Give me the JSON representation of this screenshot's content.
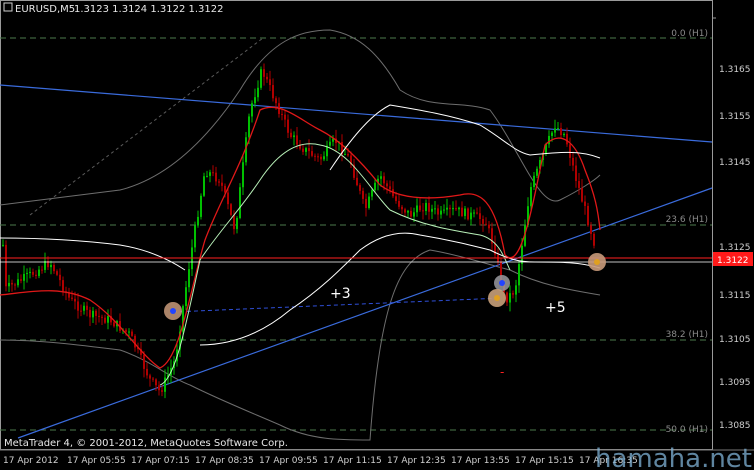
{
  "header": {
    "symbol": "EURUSD,M5",
    "quote": "1.3123 1.3124 1.3122 1.3122"
  },
  "price_axis": {
    "ticks": [
      "1.3165",
      "1.3155",
      "1.3145",
      "1.3125",
      "1.3115",
      "1.3105",
      "1.3095",
      "1.3085"
    ],
    "current_price": "1.3122"
  },
  "fib_levels": [
    "0.0 (H1)",
    "23.6 (H1)",
    "38.2 (H1)",
    "50.0 (H1)"
  ],
  "time_axis": [
    "17 Apr 2012",
    "17 Apr 05:55",
    "17 Apr 07:15",
    "17 Apr 08:35",
    "17 Apr 09:55",
    "17 Apr 11:15",
    "17 Apr 12:35",
    "17 Apr 13:55",
    "17 Apr 15:15",
    "17 Apr 16:35"
  ],
  "annotations": [
    "+3",
    "+5",
    "-"
  ],
  "footer": {
    "copyright": "MetaTrader 4, © 2001-2012, MetaQuotes Software Corp."
  },
  "watermark": "hamaha.net",
  "colors": {
    "background": "#000000",
    "bull_candle": "#00c000",
    "bear_candle": "#b00000",
    "trend_line": "#3a6bdc",
    "fast_ma": "#e01818",
    "slow_ma": "#ffffff",
    "envelope": "#7a7a7a",
    "grid": "#4a6a4a",
    "price_line": "#ff2020"
  }
}
